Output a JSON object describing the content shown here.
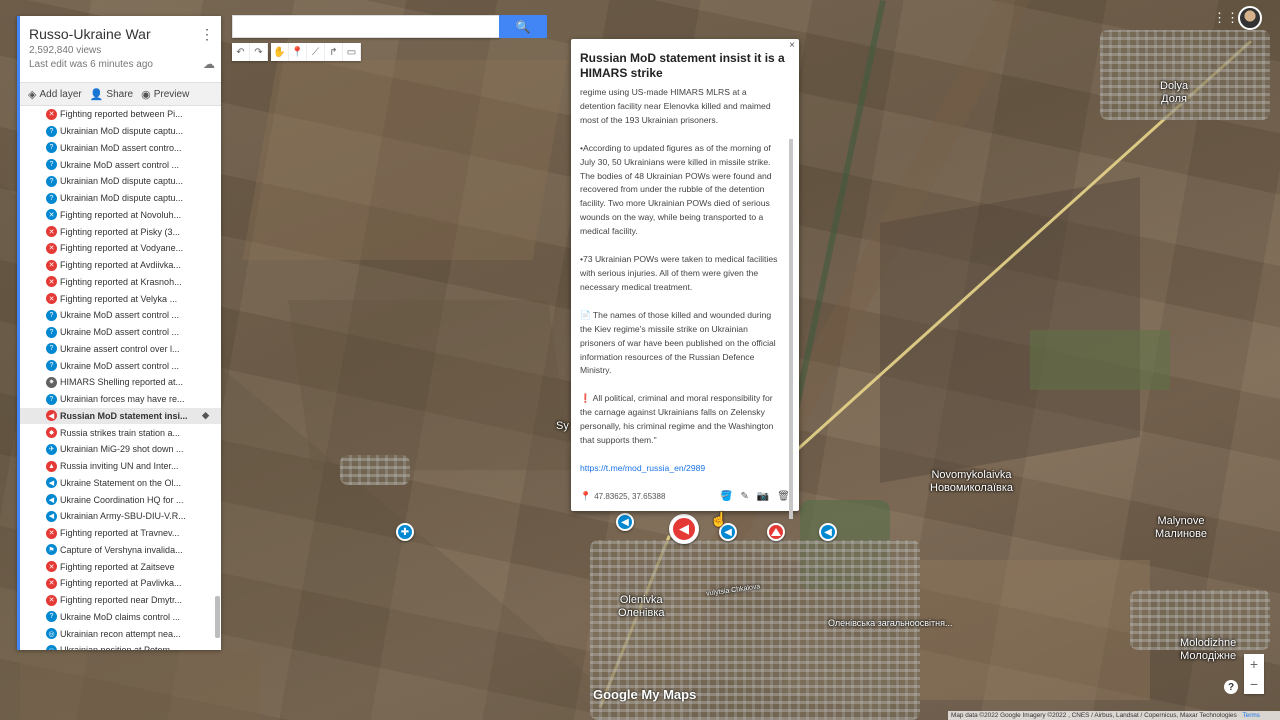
{
  "map": {
    "title": "Russo-Ukraine War",
    "views": "2,592,840 views",
    "last_edit": "Last edit was 6 minutes ago"
  },
  "panel_actions": {
    "add_layer": "Add layer",
    "share": "Share",
    "preview": "Preview"
  },
  "layer_items": [
    {
      "label": "Fighting reported between Pi...",
      "icon": "crossed-swords-icon",
      "color": "red"
    },
    {
      "label": "Ukrainian MoD dispute captu...",
      "icon": "question-icon",
      "color": "blue"
    },
    {
      "label": "Ukrainian MoD assert contro...",
      "icon": "question-icon",
      "color": "blue"
    },
    {
      "label": "Ukraine MoD assert control ...",
      "icon": "question-icon",
      "color": "blue"
    },
    {
      "label": "Ukrainian MoD dispute captu...",
      "icon": "question-icon",
      "color": "blue"
    },
    {
      "label": "Ukrainian MoD dispute captu...",
      "icon": "question-icon",
      "color": "blue"
    },
    {
      "label": "Fighting reported at Novoluh...",
      "icon": "crossed-swords-icon",
      "color": "blue"
    },
    {
      "label": "Fighting reported at Pisky (3...",
      "icon": "crossed-swords-icon",
      "color": "red"
    },
    {
      "label": "Fighting reported at Vodyane...",
      "icon": "crossed-swords-icon",
      "color": "red"
    },
    {
      "label": "Fighting reported at Avdiivka...",
      "icon": "crossed-swords-icon",
      "color": "red"
    },
    {
      "label": "Fighting reported at Krasnoh...",
      "icon": "crossed-swords-icon",
      "color": "red"
    },
    {
      "label": "Fighting reported at Velyka ...",
      "icon": "crossed-swords-icon",
      "color": "red"
    },
    {
      "label": "Ukraine MoD assert control ...",
      "icon": "question-icon",
      "color": "blue"
    },
    {
      "label": "Ukraine MoD assert control ...",
      "icon": "question-icon",
      "color": "blue"
    },
    {
      "label": "Ukraine assert control over l...",
      "icon": "question-icon",
      "color": "blue"
    },
    {
      "label": "Ukraine MoD assert control ...",
      "icon": "question-icon",
      "color": "blue"
    },
    {
      "label": "HIMARS Shelling reported at...",
      "icon": "star-icon",
      "color": "gray"
    },
    {
      "label": "Ukrainian forces may have re...",
      "icon": "question-icon",
      "color": "blue"
    },
    {
      "label": "Russian MoD statement insi...",
      "icon": "megaphone-icon",
      "color": "red",
      "active": true
    },
    {
      "label": "Russia strikes train station a...",
      "icon": "explosion-icon",
      "color": "red"
    },
    {
      "label": "Ukrainian MiG-29 shot down ...",
      "icon": "plane-icon",
      "color": "blue"
    },
    {
      "label": "Russia inviting UN and Inter...",
      "icon": "triangle-icon",
      "color": "red"
    },
    {
      "label": "Ukraine Statement on the Ol...",
      "icon": "megaphone-icon",
      "color": "blue"
    },
    {
      "label": "Ukraine Coordination HQ for ...",
      "icon": "megaphone-icon",
      "color": "blue"
    },
    {
      "label": "Ukrainian Army-SBU-DIU-V.R...",
      "icon": "megaphone-icon",
      "color": "blue"
    },
    {
      "label": "Fighting reported at Travnev...",
      "icon": "crossed-swords-icon",
      "color": "red"
    },
    {
      "label": "Capture of Vershyna invalida...",
      "icon": "flag-icon",
      "color": "blue"
    },
    {
      "label": "Fighting reported at Zaitseve",
      "icon": "crossed-swords-icon",
      "color": "red"
    },
    {
      "label": "Fighting reported at Pavlivka...",
      "icon": "crossed-swords-icon",
      "color": "red"
    },
    {
      "label": "Fighting reported near Dmytr...",
      "icon": "crossed-swords-icon",
      "color": "red"
    },
    {
      "label": "Ukraine MoD claims control ...",
      "icon": "question-icon",
      "color": "blue"
    },
    {
      "label": "Ukrainian recon attempt nea...",
      "icon": "binoculars-icon",
      "color": "blue"
    },
    {
      "label": "Ukrainian position at Potom...",
      "icon": "person-icon",
      "color": "blue"
    }
  ],
  "search": {
    "placeholder": "",
    "button_icon": "search-icon"
  },
  "card": {
    "title": "Russian MoD statement insist it is a HIMARS strike",
    "paragraphs": [
      "regime using US-made HIMARS MLRS at a detention facility near Elenovka killed and maimed most of the 193 Ukrainian prisoners.",
      "•According to updated figures as of the morning of July 30, 50 Ukrainians were killed in missile strike. The bodies of 48 Ukrainian POWs were found and recovered from under the rubble of the detention facility. Two more Ukrainian POWs died of serious wounds on the way, while being transported to a medical facility.",
      "•73 Ukrainian POWs were taken to medical facilities with serious injuries. All of them were given the necessary medical treatment.",
      "📄 The names of those killed and wounded during the Kiev regime's missile strike on Ukrainian prisoners of war have been published on the official information resources of the Russian Defence Ministry.",
      "❗ All political, criminal and moral responsibility for the carnage against Ukrainians falls on Zelensky personally, his criminal regime and the Washington that supports them.\""
    ],
    "link": "https://t.me/mod_russia_en/2989",
    "coordinates": "47.83625, 37.65388",
    "close": "×"
  },
  "map_labels": {
    "dolya": "Dolya\nДоля",
    "novomykolaivka": "Novomykolaivka\nНовомиколаївка",
    "malynove": "Malynove\nМалинове",
    "olenivka": "Olenivka\nОленівка",
    "molodizhne": "Molodizhne\nМолодіжне",
    "school": "Оленівська загальноосвітня...",
    "street": "vulytsia Chkalova",
    "sy": "Sy"
  },
  "attribution": "Map data ©2022 Google Imagery ©2022 , CNES / Airbus, Landsat / Copernicus, Maxar Technologies",
  "terms": "Terms",
  "logo": {
    "g": "Google",
    "rest": " My Maps"
  },
  "zoom": {
    "plus": "+",
    "minus": "−"
  },
  "help": "?"
}
